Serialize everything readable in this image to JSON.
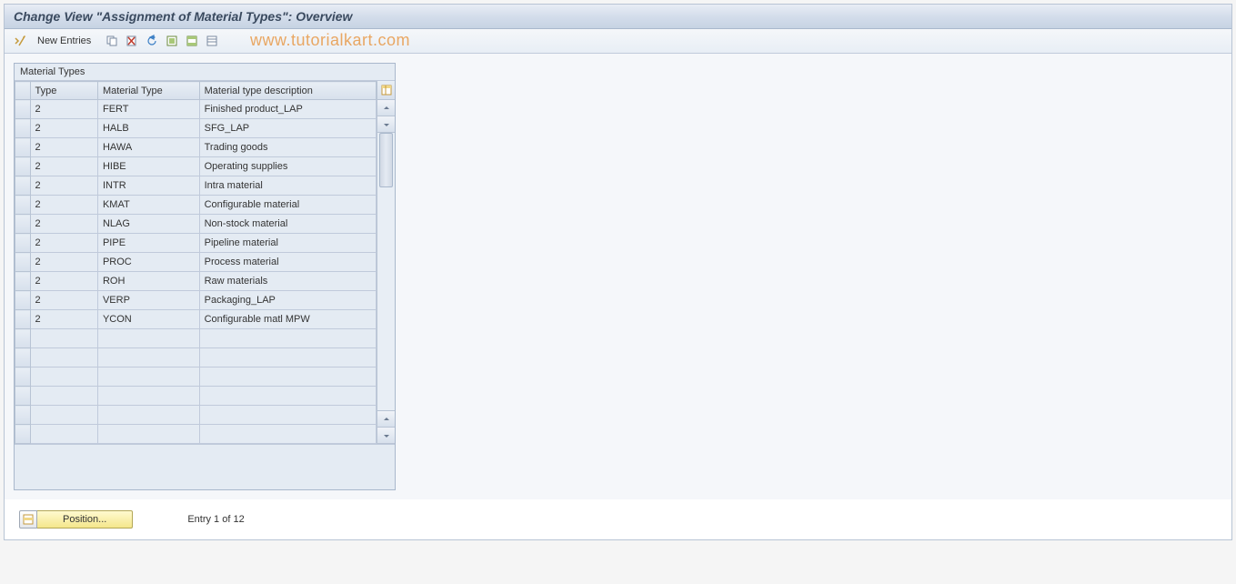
{
  "header": {
    "title": "Change View \"Assignment of Material Types\": Overview"
  },
  "toolbar": {
    "new_entries_label": "New Entries",
    "watermark": "www.tutorialkart.com"
  },
  "panel": {
    "title": "Material Types"
  },
  "table": {
    "columns": {
      "type": "Type",
      "material_type": "Material Type",
      "description": "Material type description"
    },
    "rows": [
      {
        "type": "2",
        "mtype": "FERT",
        "desc": "Finished product_LAP"
      },
      {
        "type": "2",
        "mtype": "HALB",
        "desc": "SFG_LAP"
      },
      {
        "type": "2",
        "mtype": "HAWA",
        "desc": "Trading goods"
      },
      {
        "type": "2",
        "mtype": "HIBE",
        "desc": "Operating supplies"
      },
      {
        "type": "2",
        "mtype": "INTR",
        "desc": "Intra material"
      },
      {
        "type": "2",
        "mtype": "KMAT",
        "desc": "Configurable material"
      },
      {
        "type": "2",
        "mtype": "NLAG",
        "desc": "Non-stock material"
      },
      {
        "type": "2",
        "mtype": "PIPE",
        "desc": "Pipeline material"
      },
      {
        "type": "2",
        "mtype": "PROC",
        "desc": "Process material"
      },
      {
        "type": "2",
        "mtype": "ROH",
        "desc": "Raw materials"
      },
      {
        "type": "2",
        "mtype": "VERP",
        "desc": "Packaging_LAP"
      },
      {
        "type": "2",
        "mtype": "YCON",
        "desc": "Configurable matl MPW"
      },
      {
        "type": "",
        "mtype": "",
        "desc": ""
      },
      {
        "type": "",
        "mtype": "",
        "desc": ""
      },
      {
        "type": "",
        "mtype": "",
        "desc": ""
      },
      {
        "type": "",
        "mtype": "",
        "desc": ""
      },
      {
        "type": "",
        "mtype": "",
        "desc": ""
      },
      {
        "type": "",
        "mtype": "",
        "desc": ""
      }
    ]
  },
  "footer": {
    "position_label": "Position...",
    "entry_text": "Entry 1 of 12"
  }
}
